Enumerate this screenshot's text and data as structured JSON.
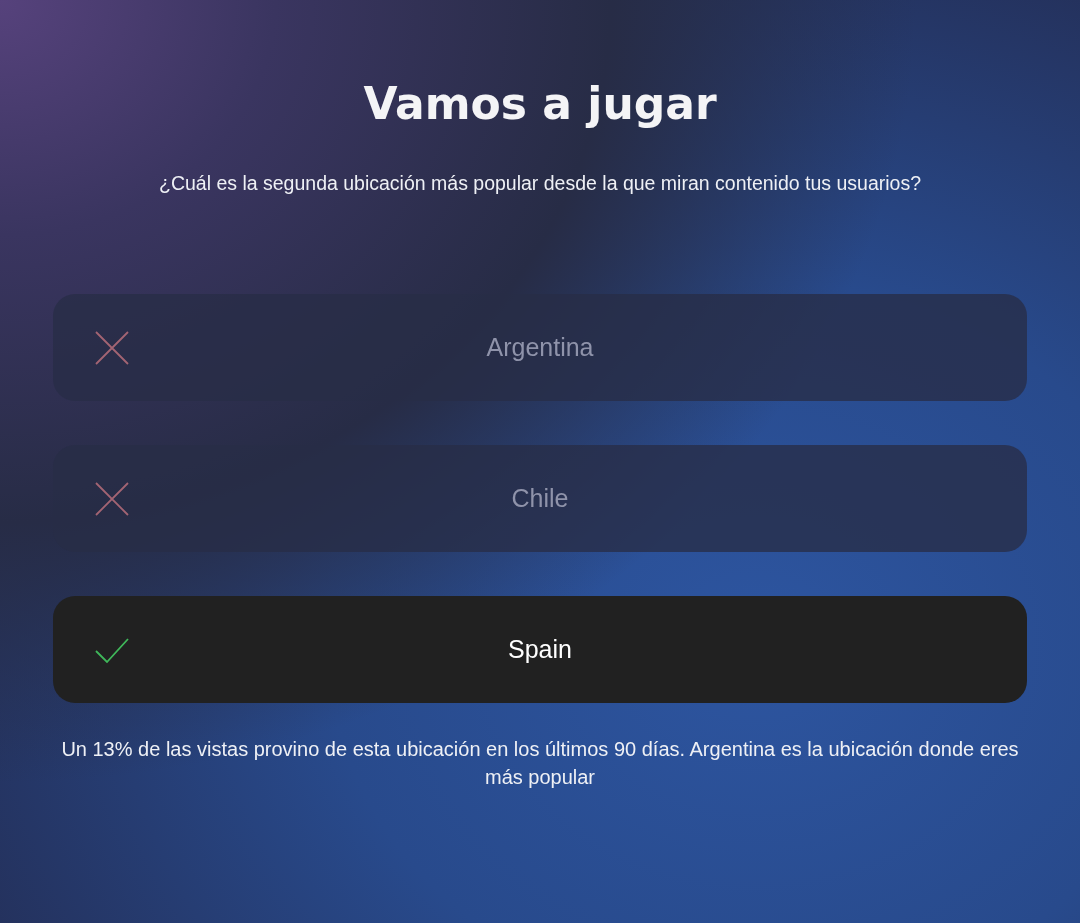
{
  "title": "Vamos a jugar",
  "question": "¿Cuál es la segunda ubicación más popular desde la que miran contenido tus usuarios?",
  "options": [
    {
      "label": "Argentina",
      "kind": "wrong"
    },
    {
      "label": "Chile",
      "kind": "wrong"
    },
    {
      "label": "Spain",
      "kind": "correct"
    }
  ],
  "explanation": "Un 13% de las vistas provino de esta ubicación en los últimos 90 días. Argentina es la ubicación donde eres más popular"
}
